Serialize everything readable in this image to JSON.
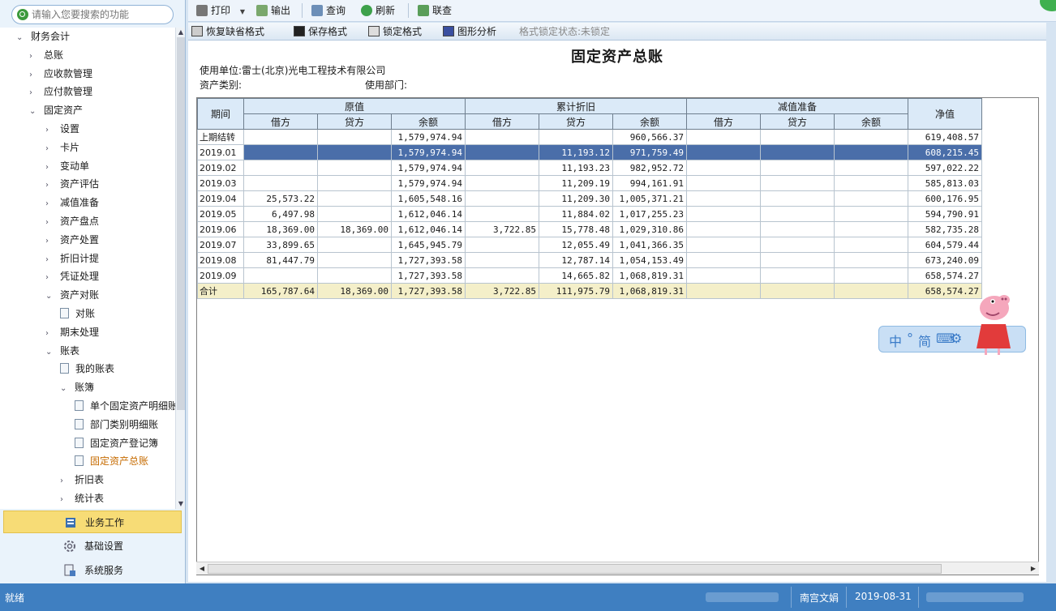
{
  "search": {
    "placeholder": "请输入您要搜索的功能"
  },
  "tree": [
    {
      "label": "财务会计",
      "level": 0,
      "state": "open"
    },
    {
      "label": "总账",
      "level": 1,
      "state": "closed"
    },
    {
      "label": "应收款管理",
      "level": 1,
      "state": "closed"
    },
    {
      "label": "应付款管理",
      "level": 1,
      "state": "closed"
    },
    {
      "label": "固定资产",
      "level": 1,
      "state": "open"
    },
    {
      "label": "设置",
      "level": 2,
      "state": "closed"
    },
    {
      "label": "卡片",
      "level": 2,
      "state": "closed"
    },
    {
      "label": "变动单",
      "level": 2,
      "state": "closed"
    },
    {
      "label": "资产评估",
      "level": 2,
      "state": "closed"
    },
    {
      "label": "减值准备",
      "level": 2,
      "state": "closed"
    },
    {
      "label": "资产盘点",
      "level": 2,
      "state": "closed"
    },
    {
      "label": "资产处置",
      "level": 2,
      "state": "closed"
    },
    {
      "label": "折旧计提",
      "level": 2,
      "state": "closed"
    },
    {
      "label": "凭证处理",
      "level": 2,
      "state": "closed"
    },
    {
      "label": "资产对账",
      "level": 2,
      "state": "open"
    },
    {
      "label": "对账",
      "level": 3,
      "state": "leaf"
    },
    {
      "label": "期末处理",
      "level": 2,
      "state": "closed"
    },
    {
      "label": "账表",
      "level": 2,
      "state": "open"
    },
    {
      "label": "我的账表",
      "level": 3,
      "state": "leaf"
    },
    {
      "label": "账簿",
      "level": 3,
      "state": "open"
    },
    {
      "label": "单个固定资产明细账",
      "level": 4,
      "state": "leaf"
    },
    {
      "label": "部门类别明细账",
      "level": 4,
      "state": "leaf"
    },
    {
      "label": "固定资产登记簿",
      "level": 4,
      "state": "leaf"
    },
    {
      "label": "固定资产总账",
      "level": 4,
      "state": "leaf",
      "active": true
    },
    {
      "label": "折旧表",
      "level": 3,
      "state": "closed"
    },
    {
      "label": "统计表",
      "level": 3,
      "state": "closed"
    }
  ],
  "nav": {
    "business": "业务工作",
    "base": "基础设置",
    "system": "系统服务"
  },
  "toolbar": {
    "print": "打印",
    "export": "输出",
    "query": "查询",
    "refresh": "刷新",
    "link_query": "联查"
  },
  "toolbar2": {
    "restore": "恢复缺省格式",
    "save": "保存格式",
    "lock": "锁定格式",
    "graph": "图形分析",
    "lock_state": "格式锁定状态:未锁定"
  },
  "report": {
    "title": "固定资产总账",
    "unit": "使用单位:雷士(北京)光电工程技术有限公司",
    "asset_category": "资产类别:",
    "department": "使用部门:"
  },
  "columns": {
    "period": "期间",
    "original": "原值",
    "accum_dep": "累计折旧",
    "impairment": "减值准备",
    "net": "净值",
    "debit": "借方",
    "credit": "贷方",
    "balance": "余额"
  },
  "rows": [
    {
      "period": "上期结转",
      "c": [
        "",
        "",
        "1,579,974.94",
        "",
        "",
        "960,566.37",
        "",
        "",
        "",
        "619,408.57"
      ]
    },
    {
      "period": "2019.01",
      "selected": true,
      "c": [
        "",
        "",
        "1,579,974.94",
        "",
        "11,193.12",
        "971,759.49",
        "",
        "",
        "",
        "608,215.45"
      ]
    },
    {
      "period": "2019.02",
      "c": [
        "",
        "",
        "1,579,974.94",
        "",
        "11,193.23",
        "982,952.72",
        "",
        "",
        "",
        "597,022.22"
      ]
    },
    {
      "period": "2019.03",
      "c": [
        "",
        "",
        "1,579,974.94",
        "",
        "11,209.19",
        "994,161.91",
        "",
        "",
        "",
        "585,813.03"
      ]
    },
    {
      "period": "2019.04",
      "c": [
        "25,573.22",
        "",
        "1,605,548.16",
        "",
        "11,209.30",
        "1,005,371.21",
        "",
        "",
        "",
        "600,176.95"
      ]
    },
    {
      "period": "2019.05",
      "c": [
        "6,497.98",
        "",
        "1,612,046.14",
        "",
        "11,884.02",
        "1,017,255.23",
        "",
        "",
        "",
        "594,790.91"
      ]
    },
    {
      "period": "2019.06",
      "c": [
        "18,369.00",
        "18,369.00",
        "1,612,046.14",
        "3,722.85",
        "15,778.48",
        "1,029,310.86",
        "",
        "",
        "",
        "582,735.28"
      ]
    },
    {
      "period": "2019.07",
      "c": [
        "33,899.65",
        "",
        "1,645,945.79",
        "",
        "12,055.49",
        "1,041,366.35",
        "",
        "",
        "",
        "604,579.44"
      ]
    },
    {
      "period": "2019.08",
      "c": [
        "81,447.79",
        "",
        "1,727,393.58",
        "",
        "12,787.14",
        "1,054,153.49",
        "",
        "",
        "",
        "673,240.09"
      ]
    },
    {
      "period": "2019.09",
      "c": [
        "",
        "",
        "1,727,393.58",
        "",
        "14,665.82",
        "1,068,819.31",
        "",
        "",
        "",
        "658,574.27"
      ]
    },
    {
      "period": "合计",
      "total": true,
      "c": [
        "165,787.64",
        "18,369.00",
        "1,727,393.58",
        "3,722.85",
        "111,975.79",
        "1,068,819.31",
        "",
        "",
        "",
        "658,574.27"
      ]
    }
  ],
  "ime": {
    "lang": "中",
    "punct": "°",
    "mode": "简",
    "keyboard": "⌨",
    "settings": "⚙"
  },
  "status": {
    "ready": "就绪",
    "user": "南宫文娟",
    "date": "2019-08-31"
  }
}
